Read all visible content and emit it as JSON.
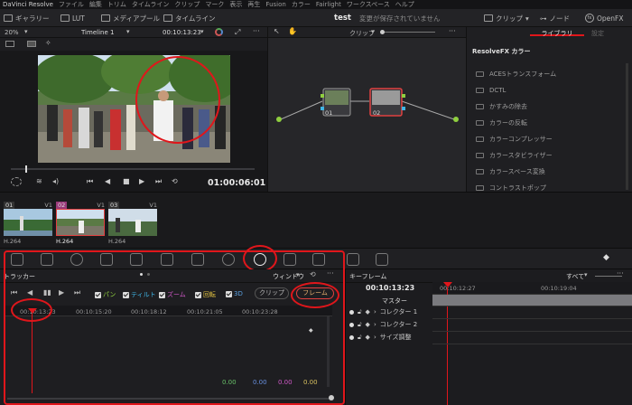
{
  "menu": {
    "items": [
      "DaVinci Resolve",
      "ファイル",
      "編集",
      "トリム",
      "タイムライン",
      "クリップ",
      "マーク",
      "表示",
      "再生",
      "Fusion",
      "カラー",
      "Fairlight",
      "ワークスペース",
      "ヘルプ"
    ]
  },
  "toolbar": {
    "gallery": "ギャラリー",
    "lut": "LUT",
    "media_pool": "メディアプール",
    "timeline": "タイムライン",
    "project_name": "test",
    "save_status": "変更が保存されていません",
    "clip": "クリップ",
    "node": "ノード",
    "openfx": "OpenFX"
  },
  "viewer": {
    "zoom": "20%",
    "timeline_name": "Timeline 1",
    "timecode": "00:10:13:23",
    "playhead_tc": "01:00:06:01"
  },
  "nodes": {
    "mode": "クリップ",
    "node1_label": "01",
    "node2_label": "02"
  },
  "library": {
    "tab_library": "ライブラリ",
    "tab_settings": "設定",
    "category": "ResolveFX カラー",
    "items": [
      "ACESトランスフォーム",
      "DCTL",
      "かすみの除去",
      "カラーの反転",
      "カラーコンプレッサー",
      "カラースタビライザー",
      "カラースペース変換",
      "コントラストポップ"
    ]
  },
  "clips": [
    {
      "num": "01",
      "track": "V1",
      "codec": "H.264"
    },
    {
      "num": "02",
      "track": "V1",
      "codec": "H.264"
    },
    {
      "num": "03",
      "track": "V1",
      "codec": "H.264"
    }
  ],
  "tracker": {
    "title": "トラッカー",
    "window_mode": "ウィンドウ",
    "checks": [
      "パン",
      "ティルト",
      "ズーム",
      "回転",
      "3D"
    ],
    "clip_btn": "クリップ",
    "frame_btn": "フレーム",
    "ruler": [
      "00:10:13:23",
      "00:10:15:20",
      "00:10:18:12",
      "00:10:21:05",
      "00:10:23:28"
    ],
    "values": [
      "0.00",
      "0.00",
      "0.00",
      "0.00"
    ]
  },
  "keyframes": {
    "title": "キーフレーム",
    "filter": "すべて",
    "timecode": "00:10:13:23",
    "ruler": [
      "00:10:12:27",
      "00:10:19:04"
    ],
    "master": "マスター",
    "rows": [
      "コレクター 1",
      "コレクター 2",
      "サイズ調整"
    ]
  },
  "colors": {
    "accent": "#e0161b",
    "node_selected": "#e04040",
    "value_y": "#d8c060",
    "value_r": "#e06868",
    "value_g": "#68c068",
    "value_b": "#6890e0"
  }
}
